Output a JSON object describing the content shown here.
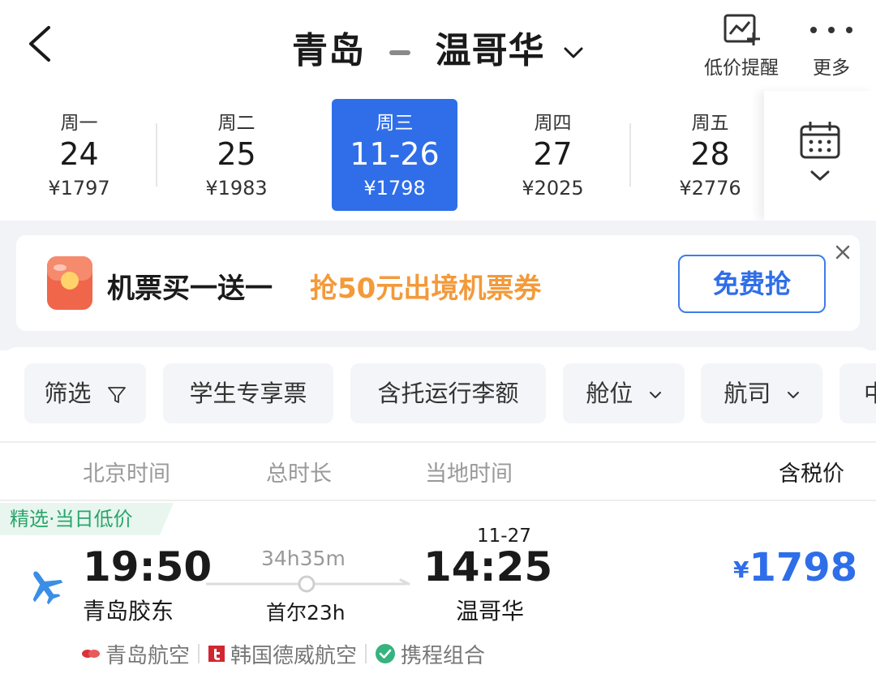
{
  "header": {
    "origin": "青岛",
    "destination": "温哥华",
    "low_price_alert_label": "低价提醒",
    "more_label": "更多"
  },
  "dates": [
    {
      "weekday": "周一",
      "day": "24",
      "price": "¥1797"
    },
    {
      "weekday": "周二",
      "day": "25",
      "price": "¥1983"
    },
    {
      "weekday": "周三",
      "day": "11-26",
      "price": "¥1798",
      "selected": true
    },
    {
      "weekday": "周四",
      "day": "27",
      "price": "¥2025"
    },
    {
      "weekday": "周五",
      "day": "28",
      "price": "¥2776"
    }
  ],
  "promo": {
    "text": "机票买一送一",
    "highlight": "抢50元出境机票券",
    "button": "免费抢"
  },
  "filters": [
    {
      "label": "筛选"
    },
    {
      "label": "学生专享票"
    },
    {
      "label": "含托运行李额"
    },
    {
      "label": "舱位"
    },
    {
      "label": "航司"
    },
    {
      "label": "中"
    }
  ],
  "columns": {
    "beijing_time": "北京时间",
    "total_duration": "总时长",
    "local_time": "当地时间",
    "price_incl_tax": "含税价"
  },
  "flight": {
    "tag": "精选·当日低价",
    "dep_time": "19:50",
    "dep_airport": "青岛胶东",
    "duration": "34h35m",
    "stopover": "首尔23h",
    "arr_date": "11-27",
    "arr_time": "14:25",
    "arr_airport": "温哥华",
    "price_currency": "¥",
    "price": "1798",
    "airlines": [
      "青岛航空",
      "韩国德威航空",
      "携程组合"
    ]
  },
  "colors": {
    "accent": "#2f6ee8",
    "promo_orange": "#f39a3a",
    "tag_green": "#2aa56b"
  }
}
